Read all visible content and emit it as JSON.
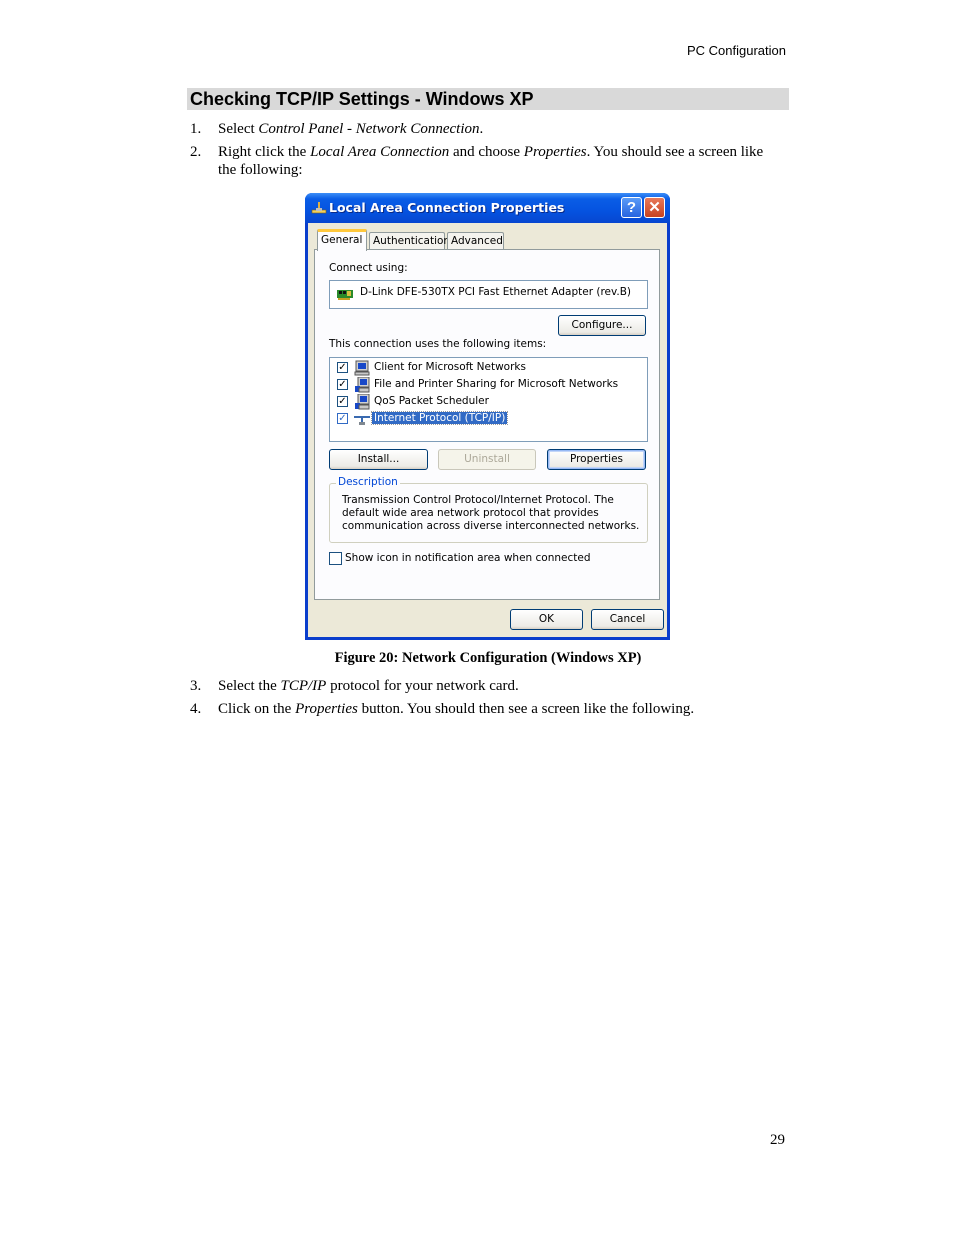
{
  "running_head": "PC Configuration",
  "section_heading": "Checking TCP/IP Settings - Windows XP",
  "steps_before": [
    {
      "num": "1.",
      "parts": [
        {
          "t": "Select "
        },
        {
          "i": "Control Panel - Network Connection"
        },
        {
          "t": "."
        }
      ]
    },
    {
      "num": "2.",
      "parts": [
        {
          "t": "Right click the "
        },
        {
          "i": "Local Area Connection"
        },
        {
          "t": " and choose "
        },
        {
          "i": "Properties"
        },
        {
          "t": ". You should see a screen like the following:"
        }
      ]
    }
  ],
  "dialog": {
    "title": "Local Area Connection Properties",
    "title_icon": "network-connection-icon",
    "help_button": "?",
    "close_button": "✕",
    "tabs": [
      {
        "label": "General",
        "active": true
      },
      {
        "label": "Authentication",
        "active": false
      },
      {
        "label": "Advanced",
        "active": false
      }
    ],
    "connect_using_label": "Connect using:",
    "adapter_name": "D-Link DFE-530TX PCI Fast Ethernet Adapter (rev.B)",
    "configure_button": "Configure...",
    "items_label": "This connection uses the following items:",
    "items": [
      {
        "label": "Client for Microsoft Networks",
        "checked": true,
        "icon": "network-client-icon",
        "selected": false
      },
      {
        "label": "File and Printer Sharing for Microsoft Networks",
        "checked": true,
        "icon": "network-service-icon",
        "selected": false
      },
      {
        "label": "QoS Packet Scheduler",
        "checked": true,
        "icon": "network-service-icon",
        "selected": false
      },
      {
        "label": "Internet Protocol (TCP/IP)",
        "checked": true,
        "icon": "network-protocol-icon",
        "selected": true
      }
    ],
    "install_button": "Install...",
    "uninstall_button": "Uninstall",
    "properties_button": "Properties",
    "description_legend": "Description",
    "description_text": "Transmission Control Protocol/Internet Protocol. The default wide area network protocol that provides communication across diverse interconnected networks.",
    "show_icon_label": "Show icon in notification area when connected",
    "show_icon_checked": false,
    "ok_button": "OK",
    "cancel_button": "Cancel"
  },
  "figure_caption": "Figure 20: Network Configuration (Windows  XP)",
  "steps_after": [
    {
      "num": "3.",
      "parts": [
        {
          "t": "Select the "
        },
        {
          "i": "TCP/IP"
        },
        {
          "t": " protocol for your network card."
        }
      ]
    },
    {
      "num": "4.",
      "parts": [
        {
          "t": "Click on the "
        },
        {
          "i": "Properties"
        },
        {
          "t": " button. You should then see a screen like the following."
        }
      ]
    }
  ],
  "page_number": "29"
}
